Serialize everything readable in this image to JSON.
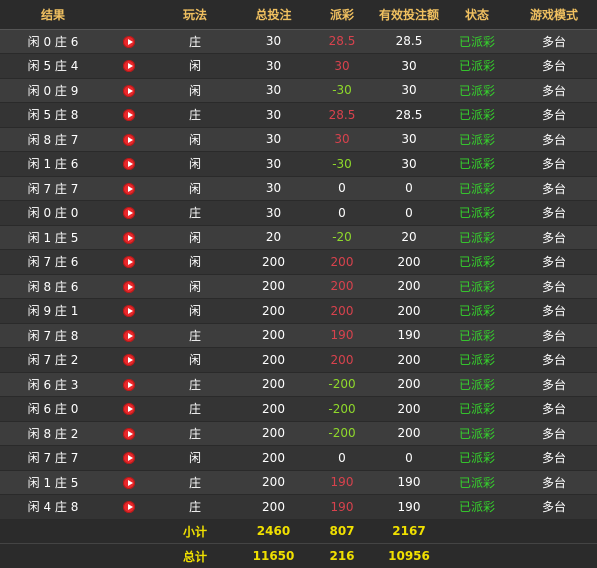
{
  "headers": [
    "结果",
    "",
    "玩法",
    "总投注",
    "派彩",
    "有效投注额",
    "状态",
    "游戏模式"
  ],
  "icons": {
    "play": "play-icon"
  },
  "colors": {
    "header": "#f0c060",
    "negative": "#8fd92b",
    "positive": "#d8424d",
    "status": "#35d32c",
    "totals": "#f0e000"
  },
  "rows": [
    {
      "result": "闲 0 庄 6",
      "play": "庄",
      "bet": "30",
      "payout": "28.5",
      "valid": "28.5",
      "status": "已派彩",
      "mode": "多台"
    },
    {
      "result": "闲 5 庄 4",
      "play": "闲",
      "bet": "30",
      "payout": "30",
      "valid": "30",
      "status": "已派彩",
      "mode": "多台"
    },
    {
      "result": "闲 0 庄 9",
      "play": "闲",
      "bet": "30",
      "payout": "-30",
      "valid": "30",
      "status": "已派彩",
      "mode": "多台"
    },
    {
      "result": "闲 5 庄 8",
      "play": "庄",
      "bet": "30",
      "payout": "28.5",
      "valid": "28.5",
      "status": "已派彩",
      "mode": "多台"
    },
    {
      "result": "闲 8 庄 7",
      "play": "闲",
      "bet": "30",
      "payout": "30",
      "valid": "30",
      "status": "已派彩",
      "mode": "多台"
    },
    {
      "result": "闲 1 庄 6",
      "play": "闲",
      "bet": "30",
      "payout": "-30",
      "valid": "30",
      "status": "已派彩",
      "mode": "多台"
    },
    {
      "result": "闲 7 庄 7",
      "play": "闲",
      "bet": "30",
      "payout": "0",
      "valid": "0",
      "status": "已派彩",
      "mode": "多台"
    },
    {
      "result": "闲 0 庄 0",
      "play": "庄",
      "bet": "30",
      "payout": "0",
      "valid": "0",
      "status": "已派彩",
      "mode": "多台"
    },
    {
      "result": "闲 1 庄 5",
      "play": "闲",
      "bet": "20",
      "payout": "-20",
      "valid": "20",
      "status": "已派彩",
      "mode": "多台"
    },
    {
      "result": "闲 7 庄 6",
      "play": "闲",
      "bet": "200",
      "payout": "200",
      "valid": "200",
      "status": "已派彩",
      "mode": "多台"
    },
    {
      "result": "闲 8 庄 6",
      "play": "闲",
      "bet": "200",
      "payout": "200",
      "valid": "200",
      "status": "已派彩",
      "mode": "多台"
    },
    {
      "result": "闲 9 庄 1",
      "play": "闲",
      "bet": "200",
      "payout": "200",
      "valid": "200",
      "status": "已派彩",
      "mode": "多台"
    },
    {
      "result": "闲 7 庄 8",
      "play": "庄",
      "bet": "200",
      "payout": "190",
      "valid": "190",
      "status": "已派彩",
      "mode": "多台"
    },
    {
      "result": "闲 7 庄 2",
      "play": "闲",
      "bet": "200",
      "payout": "200",
      "valid": "200",
      "status": "已派彩",
      "mode": "多台"
    },
    {
      "result": "闲 6 庄 3",
      "play": "庄",
      "bet": "200",
      "payout": "-200",
      "valid": "200",
      "status": "已派彩",
      "mode": "多台"
    },
    {
      "result": "闲 6 庄 0",
      "play": "庄",
      "bet": "200",
      "payout": "-200",
      "valid": "200",
      "status": "已派彩",
      "mode": "多台"
    },
    {
      "result": "闲 8 庄 2",
      "play": "庄",
      "bet": "200",
      "payout": "-200",
      "valid": "200",
      "status": "已派彩",
      "mode": "多台"
    },
    {
      "result": "闲 7 庄 7",
      "play": "闲",
      "bet": "200",
      "payout": "0",
      "valid": "0",
      "status": "已派彩",
      "mode": "多台"
    },
    {
      "result": "闲 1 庄 5",
      "play": "庄",
      "bet": "200",
      "payout": "190",
      "valid": "190",
      "status": "已派彩",
      "mode": "多台"
    },
    {
      "result": "闲 4 庄 8",
      "play": "庄",
      "bet": "200",
      "payout": "190",
      "valid": "190",
      "status": "已派彩",
      "mode": "多台"
    }
  ],
  "subtotal": {
    "label": "小计",
    "bet": "2460",
    "payout": "807",
    "valid": "2167"
  },
  "total": {
    "label": "总计",
    "bet": "11650",
    "payout": "216",
    "valid": "10956"
  }
}
